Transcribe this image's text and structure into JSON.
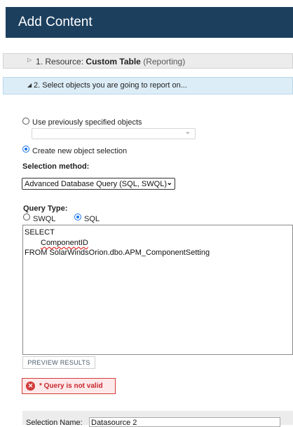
{
  "header": {
    "title": "Add Content"
  },
  "steps": [
    {
      "number": "1.",
      "prefix": "Resource:",
      "name": "Custom Table",
      "suffix": "(Reporting)",
      "arrow": "▷"
    },
    {
      "label": "2. Select objects you are going to report on...",
      "arrow": "◢"
    }
  ],
  "selection": {
    "previous_label": "Use previously specified objects",
    "previous_value": "",
    "new_label": "Create new object selection",
    "method_label": "Selection method:",
    "method_value": "Advanced Database Query (SQL, SWQL)"
  },
  "query": {
    "type_label": "Query Type:",
    "options": [
      "SWQL",
      "SQL"
    ],
    "selected": "SQL",
    "lines": [
      "SELECT",
      "ComponentID",
      "FROM SolarWindsOrion.dbo.APM_ComponentSetting"
    ]
  },
  "preview_button": "PREVIEW RESULTS",
  "error": {
    "icon": "error-icon",
    "text": "* Query is not valid"
  },
  "selection_name": {
    "label": "Selection Name:",
    "value": "Datasource 2"
  },
  "colors": {
    "header_bg": "#1c3f5e",
    "step_active_bg": "#dcedf7",
    "error": "#c8262f"
  }
}
